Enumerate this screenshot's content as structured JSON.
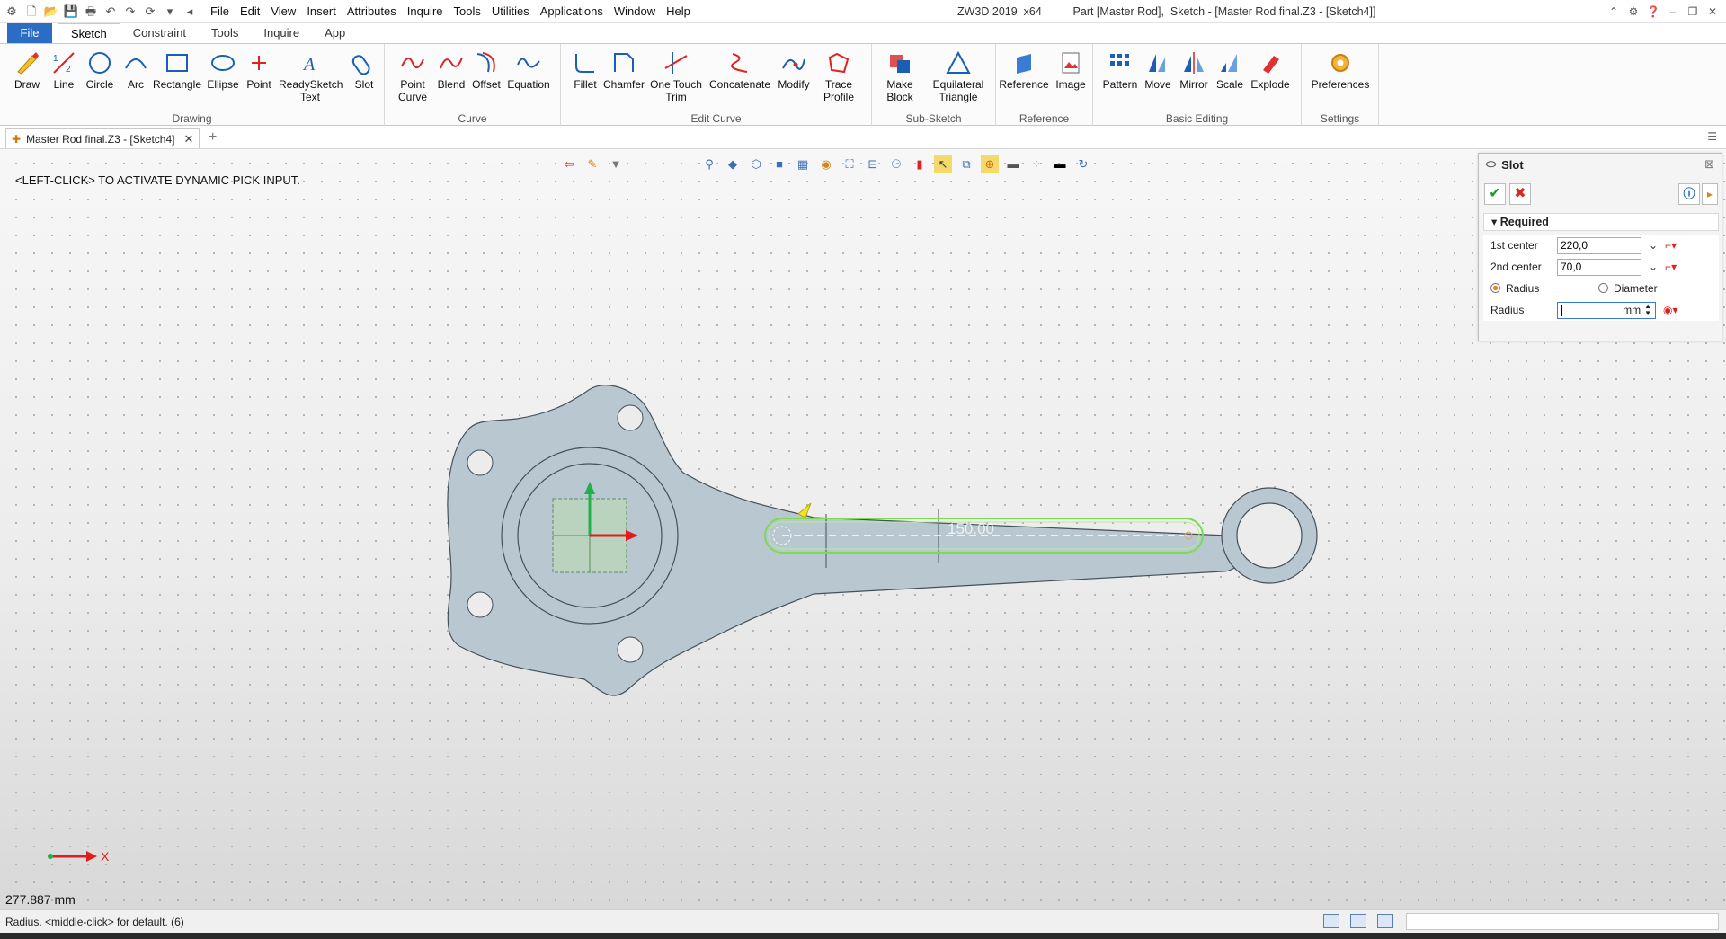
{
  "app": {
    "title": "ZW3D 2019  x64",
    "doc_title": "Part [Master Rod],  Sketch - [Master Rod final.Z3 - [Sketch4]]"
  },
  "menu": [
    "File",
    "Edit",
    "View",
    "Insert",
    "Attributes",
    "Inquire",
    "Tools",
    "Utilities",
    "Applications",
    "Window",
    "Help"
  ],
  "ribbon_tabs": [
    "File",
    "Sketch",
    "Constraint",
    "Tools",
    "Inquire",
    "App"
  ],
  "ribbon": {
    "groups": [
      "Drawing",
      "Curve",
      "Edit Curve",
      "Sub-Sketch",
      "Reference",
      "Basic Editing",
      "Settings"
    ],
    "tools": {
      "draw": "Draw",
      "line": "Line",
      "circle": "Circle",
      "arc": "Arc",
      "rectangle": "Rectangle",
      "ellipse": "Ellipse",
      "point": "Point",
      "readysketch": "ReadySketch\nText",
      "slot": "Slot",
      "pointcurve": "Point\nCurve",
      "blend": "Blend",
      "offset": "Offset",
      "equation": "Equation",
      "fillet": "Fillet",
      "chamfer": "Chamfer",
      "onetouch": "One Touch\nTrim",
      "concatenate": "Concatenate",
      "modify": "Modify",
      "trace": "Trace\nProfile",
      "makeblock": "Make\nBlock",
      "equilateral": "Equilateral\nTriangle",
      "reference": "Reference",
      "image": "Image",
      "pattern": "Pattern",
      "move": "Move",
      "mirror": "Mirror",
      "scale": "Scale",
      "explode": "Explode",
      "preferences": "Preferences"
    }
  },
  "doc_tab": {
    "label": "Master Rod final.Z3 - [Sketch4]"
  },
  "viewport": {
    "prompt": "<LEFT-CLICK> TO ACTIVATE DYNAMIC PICK INPUT.",
    "dimension": "150.00",
    "axis_label": "X",
    "coordinate": "277.887 mm"
  },
  "panel": {
    "title": "Slot",
    "section": "Required",
    "first_center_label": "1st center",
    "first_center_value": "220,0",
    "second_center_label": "2nd center",
    "second_center_value": "70,0",
    "radius_option": "Radius",
    "diameter_option": "Diameter",
    "radius_label": "Radius",
    "radius_unit": "mm"
  },
  "status": {
    "message": "Radius.  <middle-click> for default. (6)"
  },
  "colors": {
    "accent": "#2b6cc4",
    "part_fill": "#b9c7d0",
    "slot_outline": "#7ed957",
    "axis_green": "#21b14b",
    "axis_red": "#e01c1c"
  }
}
